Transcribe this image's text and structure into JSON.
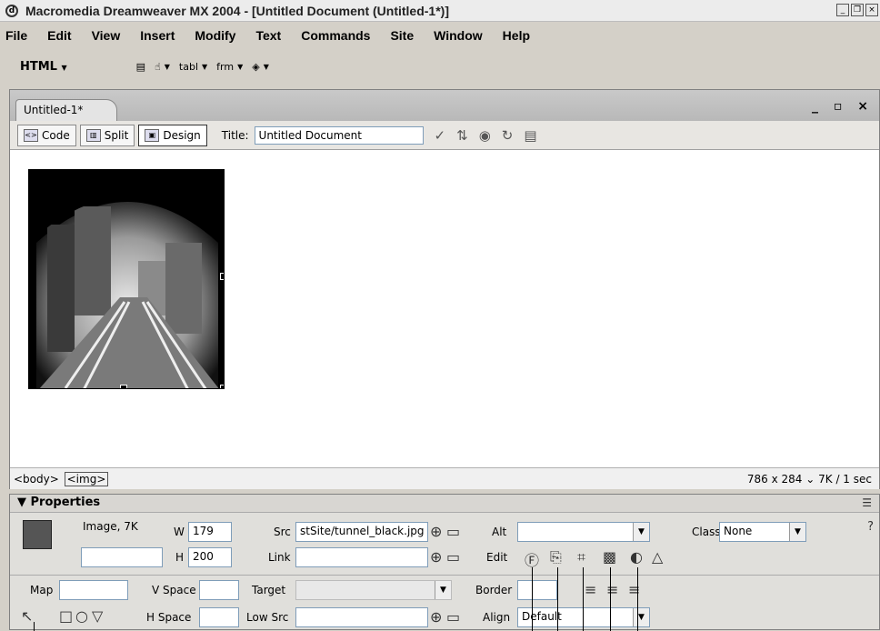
{
  "window": {
    "title": "Macromedia Dreamweaver MX 2004 - [Untitled Document (Untitled-1*)]"
  },
  "menu": [
    "File",
    "Edit",
    "View",
    "Insert",
    "Modify",
    "Text",
    "Commands",
    "Site",
    "Window",
    "Help"
  ],
  "insert_bar": {
    "category": "HTML",
    "tools": [
      "tabl",
      "frm"
    ]
  },
  "document": {
    "tab_label": "Untitled-1*",
    "views": {
      "code": "Code",
      "split": "Split",
      "design": "Design"
    },
    "title_label": "Title:",
    "title_value": "Untitled Document"
  },
  "status": {
    "tags": [
      "<body>",
      "<img>"
    ],
    "info": "786 x 284 ⌄ 7K / 1 sec"
  },
  "properties": {
    "header": "▼ Properties",
    "image_label": "Image, 7K",
    "w_label": "W",
    "w_value": "179",
    "h_label": "H",
    "h_value": "200",
    "src_label": "Src",
    "src_value": "stSite/tunnel_black.jpg",
    "link_label": "Link",
    "alt_label": "Alt",
    "edit_label": "Edit",
    "class_label": "Class",
    "class_value": "None",
    "map_label": "Map",
    "vspace_label": "V Space",
    "hspace_label": "H Space",
    "target_label": "Target",
    "lowsrc_label": "Low Src",
    "border_label": "Border",
    "align_label": "Align",
    "align_value": "Default"
  }
}
